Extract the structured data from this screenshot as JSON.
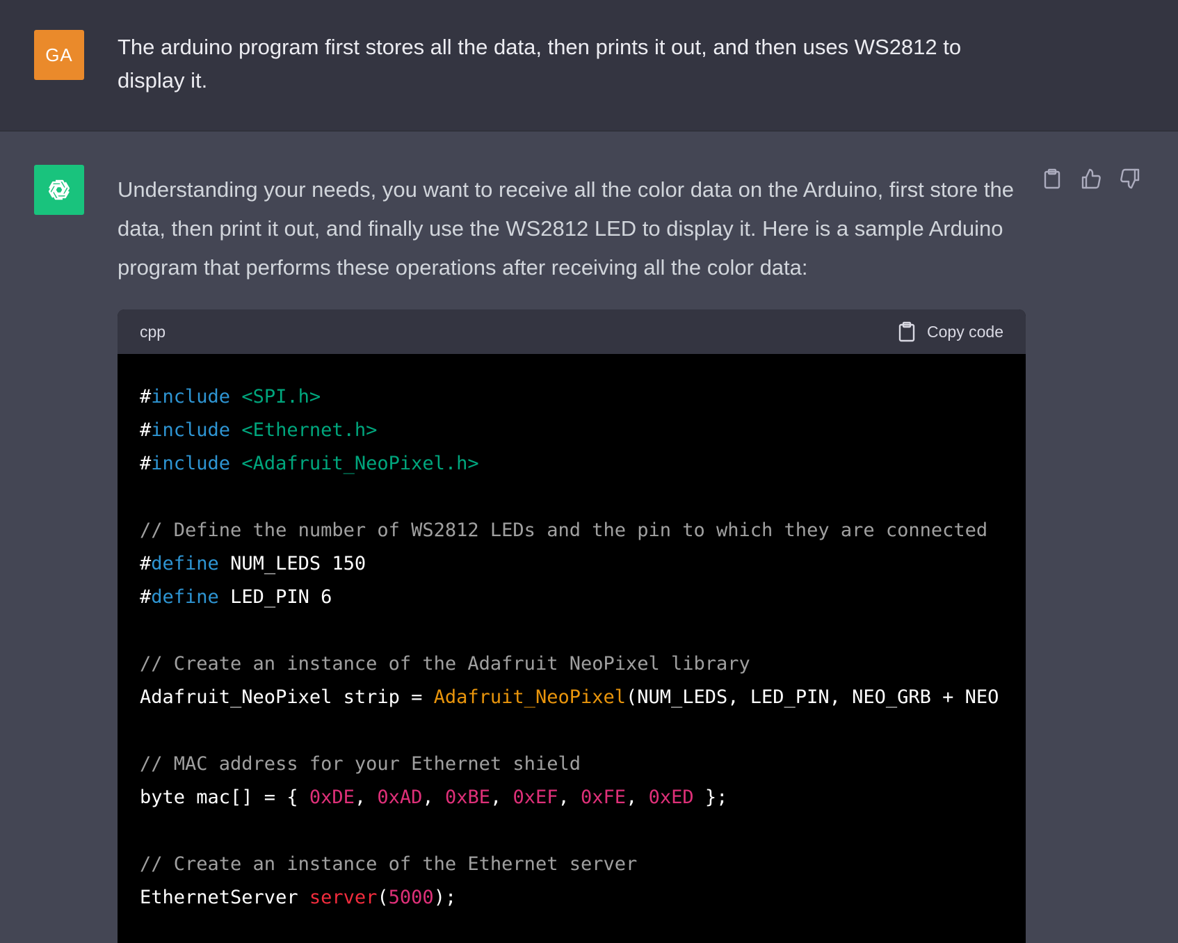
{
  "user_message": {
    "avatar_initials": "GA",
    "text": "The arduino program first stores all the data, then prints it out, and then uses WS2812 to display it."
  },
  "assistant_message": {
    "avatar_icon": "openai-logo-icon",
    "text": "Understanding your needs, you want to receive all the color data on the Arduino, first store the data, then print it out, and finally use the WS2812 LED to display it. Here is a sample Arduino program that performs these operations after receiving all the color data:",
    "actions": {
      "copy_icon": "clipboard-icon",
      "like_icon": "thumbs-up-icon",
      "dislike_icon": "thumbs-down-icon"
    },
    "code_block": {
      "language": "cpp",
      "copy_label": "Copy code",
      "lines": {
        "l1": {
          "hash": "#",
          "kw": "include",
          "str": " <SPI.h>"
        },
        "l2": {
          "hash": "#",
          "kw": "include",
          "str": " <Ethernet.h>"
        },
        "l3": {
          "hash": "#",
          "kw": "include",
          "str": " <Adafruit_NeoPixel.h>"
        },
        "l5": {
          "com": "// Define the number of WS2812 LEDs and the pin to which they are connected"
        },
        "l6": {
          "hash": "#",
          "kw": "define",
          "rest": " NUM_LEDS 150"
        },
        "l7": {
          "hash": "#",
          "kw": "define",
          "rest": " LED_PIN 6"
        },
        "l9": {
          "com": "// Create an instance of the Adafruit NeoPixel library"
        },
        "l10": {
          "pre": "Adafruit_NeoPixel strip = ",
          "title": "Adafruit_NeoPixel",
          "post": "(NUM_LEDS, LED_PIN, NEO_GRB + NEO"
        },
        "l12": {
          "com": "// MAC address for your Ethernet shield"
        },
        "l13": {
          "pre": "byte mac[] = { ",
          "n1": "0xDE",
          "n2": "0xAD",
          "n3": "0xBE",
          "n4": "0xEF",
          "n5": "0xFE",
          "n6": "0xED",
          "sep": ", ",
          "post": " };"
        },
        "l15": {
          "com": "// Create an instance of the Ethernet server"
        },
        "l16": {
          "pre": "EthernetServer ",
          "call": "server",
          "open": "(",
          "num": "5000",
          "close": ");"
        }
      }
    }
  },
  "colors": {
    "user_bg": "#343541",
    "assistant_bg": "#444654",
    "user_avatar": "#ea8a2b",
    "ai_avatar": "#19c37d",
    "code_bg": "#000000"
  }
}
